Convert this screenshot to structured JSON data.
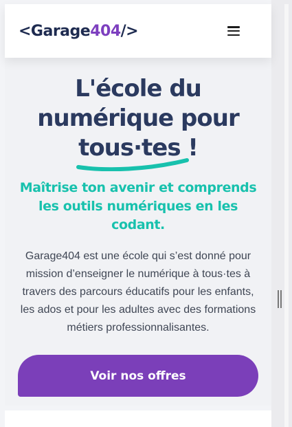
{
  "header": {
    "logo_prefix": "<Garage",
    "logo_number": "404",
    "logo_suffix": "/>",
    "menu_icon": "hamburger-menu-icon"
  },
  "hero": {
    "title_line1": "L'école du",
    "title_line2": "numérique pour",
    "title_highlight": "tous·tes",
    "title_end": " !",
    "subtitle": "Maîtrise ton avenir et comprends les outils numériques en les codant.",
    "description": "Garage404 est une école qui s’est donné pour mission d’enseigner le numérique à tous·tes à travers des parcours éducatifs pour les enfants, les ados et pour les adultes avec des formations métiers professionnalisantes.",
    "cta_label": "Voir nos offres"
  },
  "colors": {
    "brand_navy": "#2b3a5f",
    "brand_purple": "#7b3fb9",
    "accent_teal": "#18c1ad"
  }
}
